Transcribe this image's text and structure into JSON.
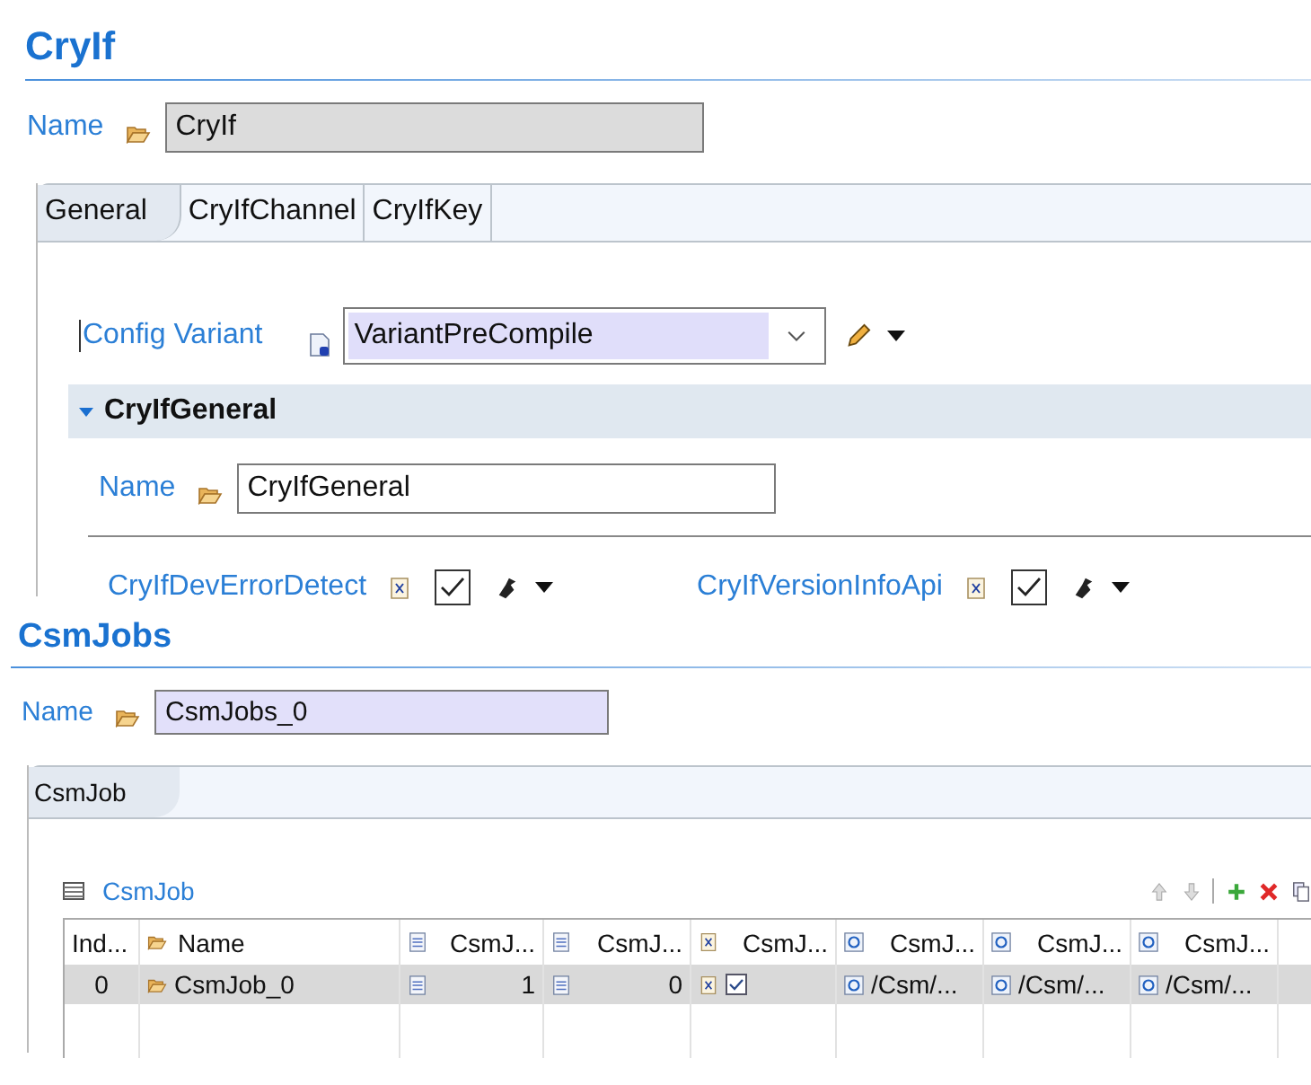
{
  "title": "CryIf",
  "name": {
    "label": "Name",
    "value": "CryIf"
  },
  "tabs": [
    {
      "label": "General",
      "selected": true
    },
    {
      "label": "CryIfChannel",
      "selected": false
    },
    {
      "label": "CryIfKey",
      "selected": false
    }
  ],
  "config_variant": {
    "label": "Config Variant",
    "value": "VariantPreCompile"
  },
  "section": {
    "title": "CryIfGeneral",
    "expanded": true,
    "name": {
      "label": "Name",
      "value": "CryIfGeneral"
    },
    "params": [
      {
        "label": "CryIfDevErrorDetect",
        "checked": true
      },
      {
        "label": "CryIfVersionInfoApi",
        "checked": true
      }
    ]
  },
  "csm_jobs": {
    "title": "CsmJobs",
    "name": {
      "label": "Name",
      "value": "CsmJobs_0"
    },
    "tabs": [
      {
        "label": "CsmJob",
        "selected": true
      }
    ],
    "table": {
      "title": "CsmJob",
      "columns": [
        {
          "label": "Ind...",
          "kind": "index"
        },
        {
          "label": "Name",
          "kind": "name"
        },
        {
          "label": "CsmJ...",
          "kind": "number"
        },
        {
          "label": "CsmJ...",
          "kind": "number"
        },
        {
          "label": "CsmJ...",
          "kind": "bool"
        },
        {
          "label": "CsmJ...",
          "kind": "ref"
        },
        {
          "label": "CsmJ...",
          "kind": "ref"
        },
        {
          "label": "CsmJ...",
          "kind": "ref"
        }
      ],
      "rows": [
        {
          "selected": true,
          "cells": [
            {
              "kind": "index",
              "value": "0"
            },
            {
              "kind": "name",
              "value": "CsmJob_0"
            },
            {
              "kind": "number",
              "value": "1"
            },
            {
              "kind": "number",
              "value": "0"
            },
            {
              "kind": "bool",
              "checked": true
            },
            {
              "kind": "ref",
              "value": "/Csm/..."
            },
            {
              "kind": "ref",
              "value": "/Csm/..."
            },
            {
              "kind": "ref",
              "value": "/Csm/..."
            }
          ]
        }
      ]
    }
  }
}
